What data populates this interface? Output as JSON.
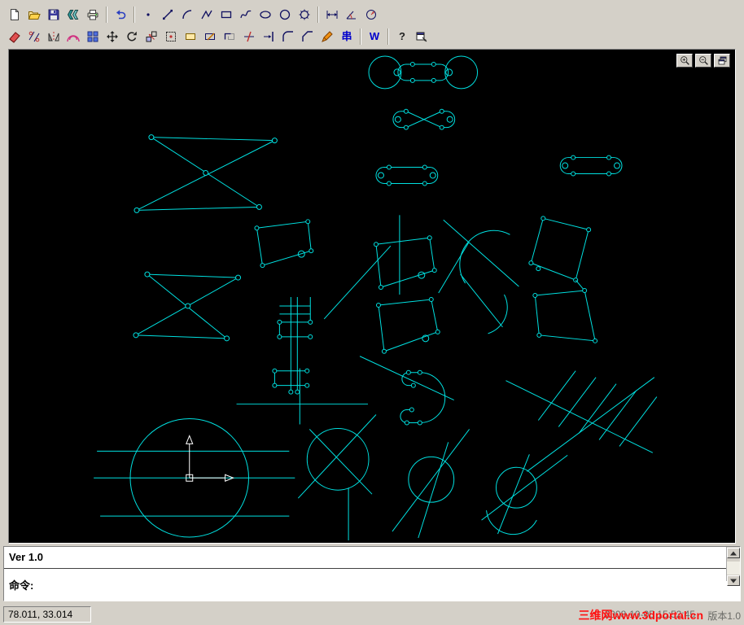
{
  "colors": {
    "chrome_background": "#d4d0c8",
    "canvas_background": "#000000",
    "drawing_stroke": "#00e0e0",
    "axis_white": "#ffffff",
    "watermark_red": "#ff1010"
  },
  "toolbar": {
    "row1": [
      {
        "name": "new-file",
        "icon": "new"
      },
      {
        "name": "open-file",
        "icon": "open"
      },
      {
        "name": "save-file",
        "icon": "save"
      },
      {
        "name": "plot-preview",
        "icon": "export"
      },
      {
        "name": "print",
        "icon": "print"
      },
      {
        "type": "separator"
      },
      {
        "name": "undo",
        "icon": "undo"
      },
      {
        "type": "separator"
      },
      {
        "name": "draw-point",
        "icon": "point"
      },
      {
        "name": "draw-line",
        "icon": "line"
      },
      {
        "name": "draw-arc",
        "icon": "arc"
      },
      {
        "name": "draw-polyline",
        "icon": "polyline"
      },
      {
        "name": "draw-rectangle",
        "icon": "rectangle"
      },
      {
        "name": "draw-spline",
        "icon": "spline"
      },
      {
        "name": "draw-ellipse",
        "icon": "ellipse"
      },
      {
        "name": "draw-circle",
        "icon": "circle"
      },
      {
        "name": "draw-gear",
        "icon": "gear"
      },
      {
        "type": "separator"
      },
      {
        "name": "dim-linear",
        "icon": "dim-horizontal"
      },
      {
        "name": "dim-angle",
        "icon": "dim-angle"
      },
      {
        "name": "dim-radius",
        "icon": "dim-radius"
      }
    ],
    "row2": [
      {
        "name": "erase",
        "icon": "erase"
      },
      {
        "name": "break",
        "icon": "break"
      },
      {
        "name": "mirror",
        "icon": "mirror"
      },
      {
        "name": "offset",
        "icon": "offset"
      },
      {
        "name": "array",
        "icon": "array"
      },
      {
        "name": "move",
        "icon": "move"
      },
      {
        "name": "rotate",
        "icon": "rotate"
      },
      {
        "name": "scale",
        "icon": "scale"
      },
      {
        "name": "zoom-window",
        "icon": "zoom-window"
      },
      {
        "name": "rect-tool",
        "icon": "rect-fill"
      },
      {
        "name": "rect-edit",
        "icon": "rect-edit"
      },
      {
        "name": "corner-rect",
        "icon": "rect-corner"
      },
      {
        "name": "trim",
        "icon": "trim"
      },
      {
        "name": "extend",
        "icon": "extend"
      },
      {
        "name": "fillet",
        "icon": "fillet"
      },
      {
        "name": "chamfer",
        "icon": "chamfer"
      },
      {
        "name": "pen",
        "icon": "pen"
      },
      {
        "name": "chain-tool",
        "icon": "chain",
        "glyph": "串",
        "color": "#0000cc"
      },
      {
        "type": "separator"
      },
      {
        "name": "w-tool",
        "icon": "w-letter",
        "glyph": "W",
        "color": "#0000cc"
      },
      {
        "type": "separator"
      },
      {
        "name": "help",
        "icon": "help",
        "glyph": "?",
        "color": "#202020"
      },
      {
        "name": "properties",
        "icon": "properties"
      }
    ]
  },
  "canvas": {
    "zoom_buttons": [
      {
        "name": "zoom-in",
        "icon": "zoom-in"
      },
      {
        "name": "zoom-out",
        "icon": "zoom-out"
      },
      {
        "name": "window-restore",
        "icon": "window-restore"
      }
    ]
  },
  "command_panel": {
    "history_line": "Ver 1.0",
    "prompt_label": "命令:"
  },
  "status_bar": {
    "coordinates": "78.011, 33.014",
    "timestamp": "2008-10-05 15:52:45",
    "version_label": "版本1.0",
    "watermark": "三维网www.3dportal.cn"
  }
}
